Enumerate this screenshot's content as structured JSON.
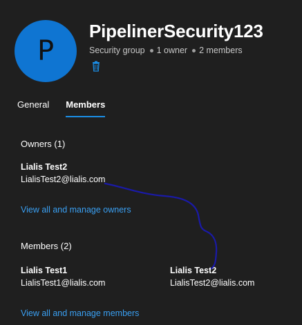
{
  "header": {
    "avatar_letter": "P",
    "title": "PipelinerSecurity123",
    "group_type": "Security group",
    "owner_count": "1 owner",
    "member_count": "2 members",
    "delete_icon": "trash-icon"
  },
  "tabs": [
    {
      "label": "General",
      "active": false
    },
    {
      "label": "Members",
      "active": true
    }
  ],
  "owners": {
    "heading": "Owners (1)",
    "people": [
      {
        "name": "Lialis Test2",
        "email": "LialisTest2@lialis.com"
      }
    ],
    "link": "View all and manage owners"
  },
  "members": {
    "heading": "Members (2)",
    "people": [
      {
        "name": "Lialis Test1",
        "email": "LialisTest1@lialis.com"
      },
      {
        "name": "Lialis Test2",
        "email": "LialisTest2@lialis.com"
      }
    ],
    "link": "View all and manage members"
  },
  "colors": {
    "background": "#1f1f1f",
    "avatar": "#0f75d2",
    "link": "#3aa0f3",
    "tab_underline": "#1b8fe8",
    "annotation": "#1a1aa8"
  }
}
